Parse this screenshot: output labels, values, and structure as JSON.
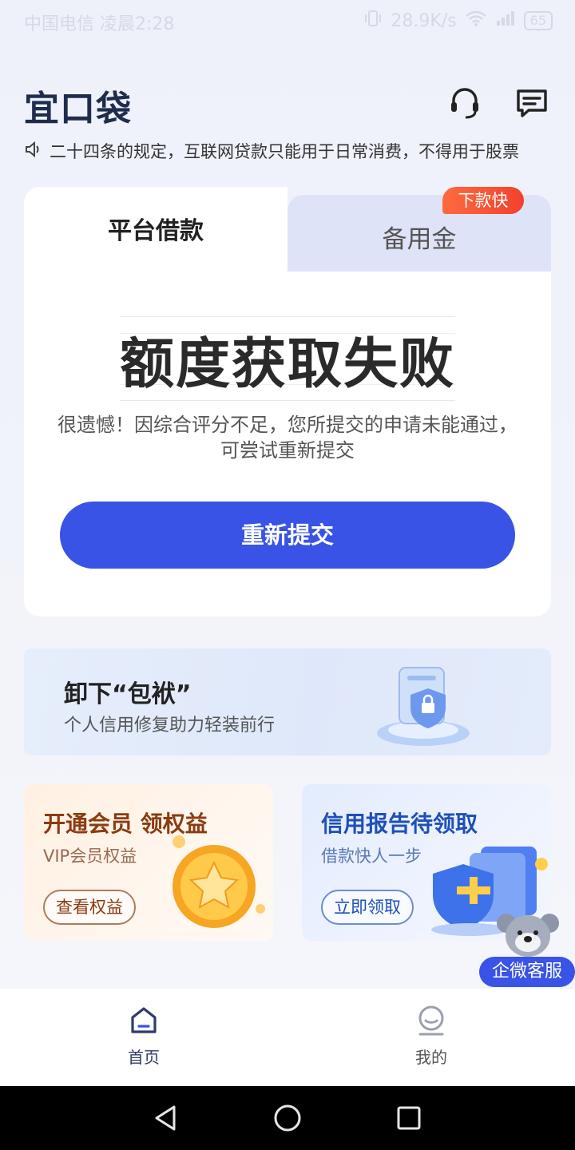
{
  "status_bar": {
    "carrier": "中国电信 凌晨2:28",
    "speed": "28.9K/s",
    "battery": "65"
  },
  "header": {
    "logo": "宜口袋",
    "icons": [
      "headset-icon",
      "message-icon"
    ]
  },
  "notice": {
    "text": "二十四条的规定，互联网贷款只能用于日常消费，不得用于股票"
  },
  "loan_card": {
    "tab_active": "平台借款",
    "tab_inactive": "备用金",
    "badge": "下款快",
    "result_title": "额度获取失败",
    "result_desc": "很遗憾！因综合评分不足，您所提交的申请未能通过，可尝试重新提交",
    "button": "重新提交"
  },
  "banner": {
    "title": "卸下“包袱”",
    "subtitle": "个人信用修复助力轻装前行"
  },
  "promos": {
    "vip": {
      "title": "开通会员 领权益",
      "subtitle": "VIP会员权益",
      "button": "查看权益"
    },
    "report": {
      "title": "信用报告待领取",
      "subtitle": "借款快人一步",
      "button": "立即领取"
    }
  },
  "customer_service": {
    "label": "企微客服"
  },
  "bottom_nav": {
    "home": "首页",
    "mine": "我的"
  },
  "colors": {
    "primary": "#3953e6",
    "badge": "#f2412e"
  }
}
